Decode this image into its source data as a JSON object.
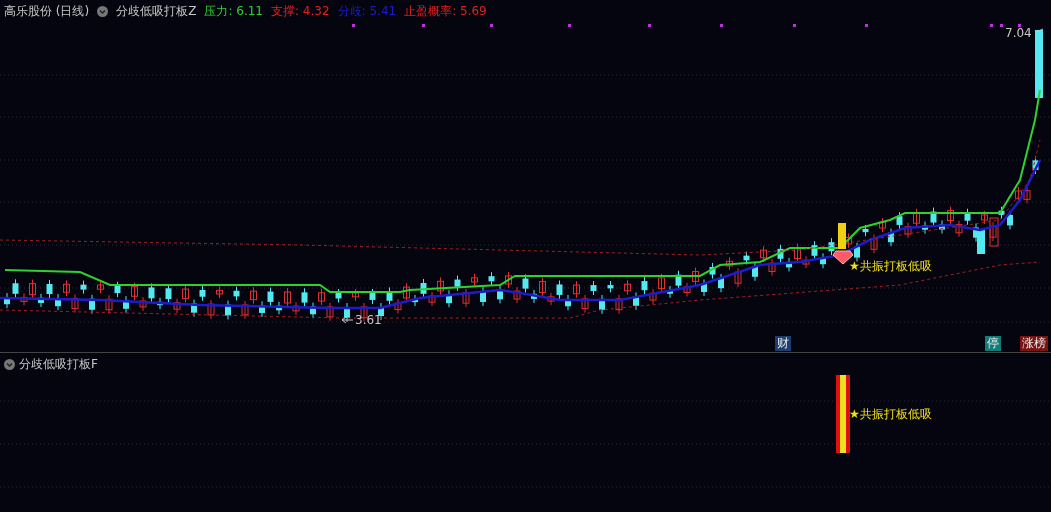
{
  "header": {
    "stock": "高乐股份 (日线)",
    "indicator": "分歧低吸打板Z",
    "legend": [
      {
        "text": "压力: 6.11",
        "color": "#2fd12f"
      },
      {
        "text": "支撑: 4.32",
        "color": "#e02020"
      },
      {
        "text": "分歧: 5.41",
        "color": "#1c1ccc"
      },
      {
        "text": "止盈概率: 5.69",
        "color": "#e02020"
      }
    ]
  },
  "main_panel": {
    "price_high": "7.04",
    "price_low": "3.61",
    "signal": "★共振打板低吸",
    "badges": [
      {
        "text": "财",
        "color": "#1c3d6e"
      },
      {
        "text": "停",
        "color": "#137c78"
      },
      {
        "text": "涨榜",
        "color": "#7a1414"
      }
    ]
  },
  "sub_panel": {
    "title": "分歧低吸打板F",
    "signal": "★共振打板低吸"
  }
}
